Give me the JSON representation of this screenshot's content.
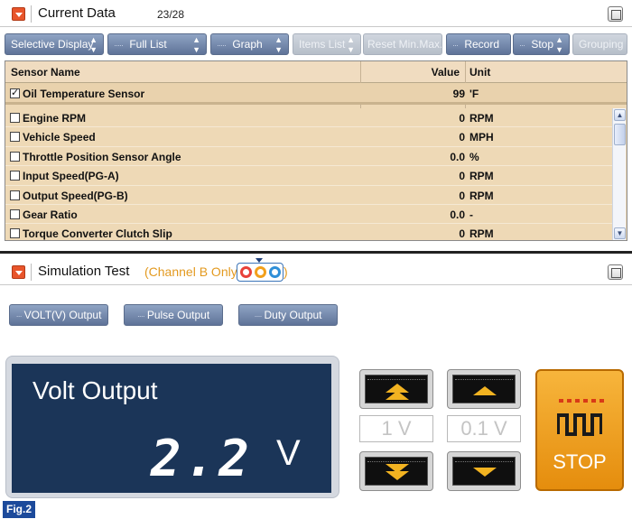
{
  "current_data": {
    "title": "Current Data",
    "count": "23/28"
  },
  "toolbar": {
    "buttons": [
      {
        "label": "Selective Display",
        "enabled": true
      },
      {
        "label": "Full List",
        "enabled": true
      },
      {
        "label": "Graph",
        "enabled": true
      },
      {
        "label": "Items List",
        "enabled": false
      },
      {
        "label": "Reset Min.Max.",
        "enabled": false
      },
      {
        "label": "Record",
        "enabled": true
      },
      {
        "label": "Stop",
        "enabled": true
      },
      {
        "label": "Grouping",
        "enabled": false
      }
    ]
  },
  "table": {
    "headers": {
      "name": "Sensor Name",
      "value": "Value",
      "unit": "Unit"
    },
    "pinned": {
      "name": "Oil Temperature Sensor",
      "value": "99",
      "unit": "'F",
      "checked": true
    },
    "rows": [
      {
        "name": "Engine RPM",
        "value": "0",
        "unit": "RPM",
        "checked": false
      },
      {
        "name": "Vehicle Speed",
        "value": "0",
        "unit": "MPH",
        "checked": false
      },
      {
        "name": "Throttle Position Sensor Angle",
        "value": "0.0",
        "unit": "%",
        "checked": false
      },
      {
        "name": "Input Speed(PG-A)",
        "value": "0",
        "unit": "RPM",
        "checked": false
      },
      {
        "name": "Output Speed(PG-B)",
        "value": "0",
        "unit": "RPM",
        "checked": false
      },
      {
        "name": "Gear Ratio",
        "value": "0.0",
        "unit": "-",
        "checked": false
      },
      {
        "name": "Torque Converter Clutch Slip",
        "value": "0",
        "unit": "RPM",
        "checked": false
      }
    ]
  },
  "simulation": {
    "title": "Simulation Test",
    "note_open": "(Channel B Only",
    "note_close": ")",
    "channel_colors": [
      "#e8413a",
      "#f2a01c",
      "#2f8fd8"
    ]
  },
  "output_buttons": {
    "volt": "VOLT(V) Output",
    "pulse": "Pulse Output",
    "duty": "Duty Output"
  },
  "volt_display": {
    "label": "Volt Output",
    "value": "2.2",
    "unit": "V"
  },
  "steps": {
    "coarse": "1 V",
    "fine": "0.1 V"
  },
  "stop_button": {
    "label": "STOP"
  },
  "figure_label": "Fig.2"
}
